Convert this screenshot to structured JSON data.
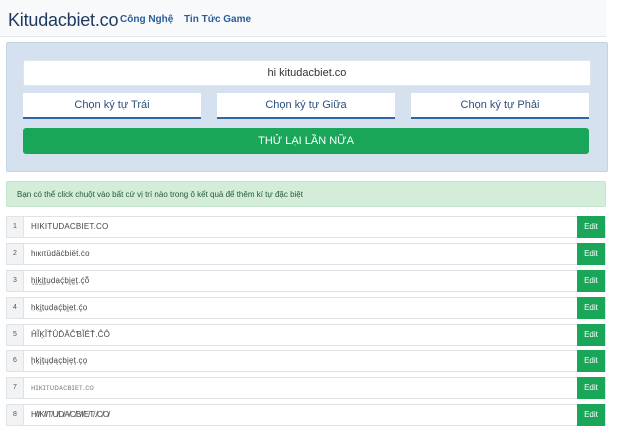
{
  "header": {
    "brand": "Kitudacbiet.co",
    "nav": [
      "Công Nghệ",
      "Tin Tức Game"
    ]
  },
  "generator": {
    "input_value": "hi kitudacbiet.co",
    "choices": [
      "Chọn ký tự Trái",
      "Chọn ký tự Giữa",
      "Chọn ký tự Phải"
    ],
    "retry_label": "THỬ LẠI LẦN NỮA"
  },
  "notice": "Bạn có thể click chuột vào bất cứ vị trí nào trong ô kết quả để thêm kí tự đặc biệt",
  "results": [
    {
      "num": "1",
      "text": "HIKITUDACBIET.CO",
      "edit": "Edit"
    },
    {
      "num": "2",
      "text": "hιкιτüdäċbiëṫ.ċo",
      "edit": "Edit"
    },
    {
      "num": "3",
      "text": "ḫḭḵḭṱṷḍạḉḅḭḛṱ.ḉṏ",
      "edit": "Edit"
    },
    {
      "num": "4",
      "text": "ḥḳḭṭụḍạḉḅḭẹṭ.ḉọ",
      "edit": "Edit"
    },
    {
      "num": "5",
      "text": "ĤĨĶĨŤÛĎÂĈƁĨÊŤ.ĈÔ",
      "edit": "Edit"
    },
    {
      "num": "6",
      "text": "ḩķįţųḑąçbįęţ.çǫ",
      "edit": "Edit"
    },
    {
      "num": "7",
      "text": "ʜɪᴋɪᴛᴜᴅᴀᴄʙɪᴇᴛ.ᴄᴏ",
      "edit": "Edit"
    },
    {
      "num": "8",
      "text": "H̸I̸K̸I̸T̸U̸D̸A̸C̸B̸I̸E̸T̸.̸C̸O̸",
      "edit": "Edit"
    }
  ],
  "colors": {
    "accent": "#1aa659",
    "panel": "#d6e1ef",
    "choice_border": "#2f66a8",
    "notice_bg": "#d3edda"
  }
}
